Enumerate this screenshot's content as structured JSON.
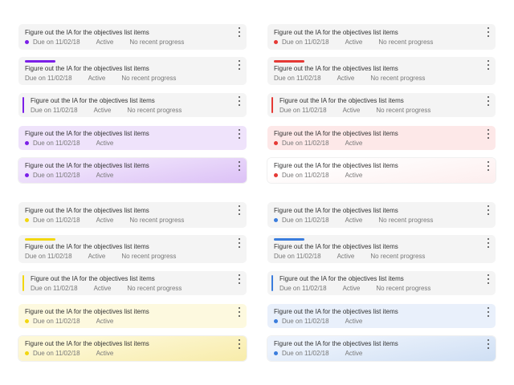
{
  "groups": [
    {
      "name": "purple",
      "color": "#7b1fe8",
      "tint": "#efe3fb",
      "grad_from": "#f1e6fc",
      "grad_to": "#dcc1f6",
      "cards": [
        {
          "variant": "dot",
          "title": "Figure out the IA for the objectives list items",
          "due": "Due on 11/02/18",
          "status": "Active",
          "progress": "No recent progress"
        },
        {
          "variant": "topbar",
          "title": "Figure out the IA for the objectives list items",
          "due": "Due on 11/02/18",
          "status": "Active",
          "progress": "No recent progress"
        },
        {
          "variant": "leftbar",
          "title": "Figure out the IA for the objectives list items",
          "due": "Due on 11/02/18",
          "status": "Active",
          "progress": "No recent progress"
        },
        {
          "variant": "tint",
          "title": "Figure out the IA for the objectives list items",
          "due": "Due on 11/02/18",
          "status": "Active"
        },
        {
          "variant": "gradient",
          "title": "Figure out the IA for the objectives list items",
          "due": "Due on 11/02/18",
          "status": "Active"
        }
      ]
    },
    {
      "name": "red",
      "color": "#e53935",
      "tint": "#fde8e8",
      "grad_from": "#ffffff",
      "grad_to": "#fdeeee",
      "cards": [
        {
          "variant": "dot",
          "title": "Figure out the IA for the objectives list items",
          "due": "Due on 11/02/18",
          "status": "Active",
          "progress": "No recent progress"
        },
        {
          "variant": "topbar",
          "title": "Figure out the IA for the objectives list items",
          "due": "Due on 11/02/18",
          "status": "Active",
          "progress": "No recent progress"
        },
        {
          "variant": "leftbar",
          "title": "Figure out the IA for the objectives list items",
          "due": "Due on 11/02/18",
          "status": "Active",
          "progress": "No recent progress"
        },
        {
          "variant": "tint",
          "title": "Figure out the IA for the objectives list items",
          "due": "Due on 11/02/18",
          "status": "Active"
        },
        {
          "variant": "gradient",
          "title": "Figure out the IA for the objectives list items",
          "due": "Due on 11/02/18",
          "status": "Active"
        }
      ]
    },
    {
      "name": "yellow",
      "color": "#f2d70f",
      "tint": "#fdf9df",
      "grad_from": "#fdf8d8",
      "grad_to": "#f8ecaa",
      "cards": [
        {
          "variant": "dot",
          "title": "Figure out the IA for the objectives list items",
          "due": "Due on 11/02/18",
          "status": "Active",
          "progress": "No recent progress"
        },
        {
          "variant": "topbar",
          "title": "Figure out the IA for the objectives list items",
          "due": "Due on 11/02/18",
          "status": "Active",
          "progress": "No recent progress"
        },
        {
          "variant": "leftbar",
          "title": "Figure out the IA for the objectives list items",
          "due": "Due on 11/02/18",
          "status": "Active",
          "progress": "No recent progress"
        },
        {
          "variant": "tint",
          "title": "Figure out the IA for the objectives list items",
          "due": "Due on 11/02/18",
          "status": "Active"
        },
        {
          "variant": "gradient",
          "title": "Figure out the IA for the objectives list items",
          "due": "Due on 11/02/18",
          "status": "Active"
        }
      ]
    },
    {
      "name": "blue",
      "color": "#3b7ddd",
      "tint": "#e9f0fb",
      "grad_from": "#edf3fc",
      "grad_to": "#cfdff4",
      "cards": [
        {
          "variant": "dot",
          "title": "Figure out the IA for the objectives list items",
          "due": "Due on 11/02/18",
          "status": "Active",
          "progress": "No recent progress"
        },
        {
          "variant": "topbar",
          "title": "Figure out the IA for the objectives list items",
          "due": "Due on 11/02/18",
          "status": "Active",
          "progress": "No recent progress"
        },
        {
          "variant": "leftbar",
          "title": "Figure out the IA for the objectives list items",
          "due": "Due on 11/02/18",
          "status": "Active",
          "progress": "No recent progress"
        },
        {
          "variant": "tint",
          "title": "Figure out the IA for the objectives list items",
          "due": "Due on 11/02/18",
          "status": "Active"
        },
        {
          "variant": "gradient",
          "title": "Figure out the IA for the objectives list items",
          "due": "Due on 11/02/18",
          "status": "Active"
        }
      ]
    }
  ]
}
